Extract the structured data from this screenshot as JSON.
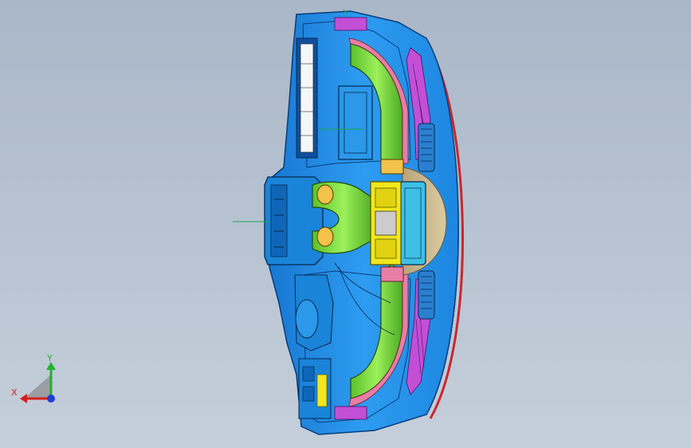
{
  "viewport": {
    "background_top": "#a9b7c8",
    "background_bottom": "#c5cfdb"
  },
  "model": {
    "name": "",
    "colors": {
      "shell": "#1e8fe6",
      "shell_dark": "#0d4f9e",
      "duct_green": "#74e03a",
      "duct_pink": "#e87ea3",
      "vent_magenta": "#c24fd6",
      "center_yellow": "#f2e61e",
      "trim_tan": "#c8b48a",
      "edge_red": "#c8282e",
      "sketch_green": "#1aa64a"
    }
  },
  "triad": {
    "x_label": "X",
    "y_label": "Y",
    "x_color": "#d41f1f",
    "y_color": "#20b32b",
    "z_color": "#1f3fd6",
    "icon": "coordinate-triad-icon"
  }
}
